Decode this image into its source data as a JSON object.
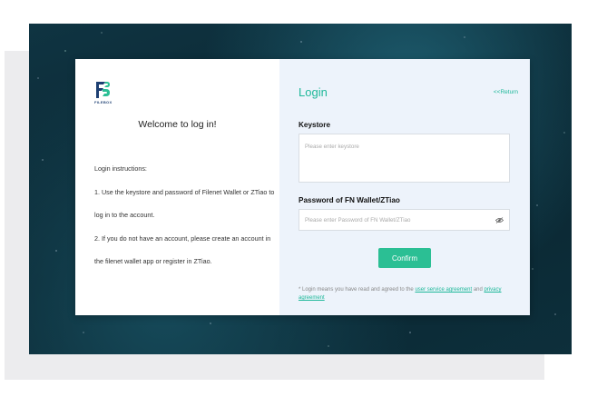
{
  "brand": {
    "logo_text": "FILEBOX"
  },
  "left_panel": {
    "welcome": "Welcome to log in!",
    "instructions": [
      "Login instructions:",
      "1. Use the keystore and password of Filenet Wallet or ZTiao to",
      "log in to the account.",
      "2. If you do not have an account, please create an account in",
      "the filenet wallet app or register in ZTiao."
    ]
  },
  "login": {
    "title": "Login",
    "return_label": "<<Return",
    "keystore_label": "Keystore",
    "keystore_placeholder": "Please enter keystore",
    "password_label": "Password of FN Wallet/ZTiao",
    "password_placeholder": "Please enter Password of FN Wallet/ZTiao",
    "confirm_label": "Confirm",
    "agreement_prefix": "* Login means you have read and agreed to the",
    "user_agreement_link": "user service agreement",
    "and_text": "and",
    "privacy_link": "privacy agreement"
  },
  "colors": {
    "accent": "#2bbf94",
    "link": "#1fb89a",
    "right_panel_bg": "#edf3fb"
  },
  "icons": [
    "filebox-logo-icon",
    "eye-off-icon"
  ]
}
